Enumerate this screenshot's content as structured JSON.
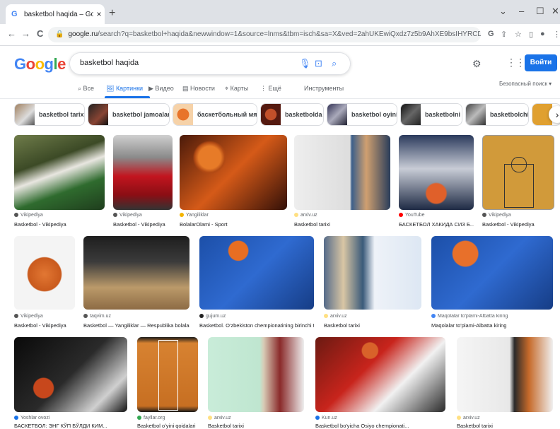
{
  "browser": {
    "tab_title": "basketbol haqida – Google Пои",
    "tab_close": "×",
    "new_tab": "+",
    "url_host": "google.ru",
    "url_rest": "/search?q=basketbol+haqida&newwindow=1&source=lnms&tbm=isch&sa=X&ved=2ahUKEwiQxdz7z5b9AhXE9bsIHYRCD6QQ_AUoAXoECAEQAw",
    "back": "←",
    "forward": "→",
    "reload": "C"
  },
  "google": {
    "logo_letters": [
      {
        "ch": "G",
        "color": "#4285f4"
      },
      {
        "ch": "o",
        "color": "#ea4335"
      },
      {
        "ch": "o",
        "color": "#fbbc05"
      },
      {
        "ch": "g",
        "color": "#4285f4"
      },
      {
        "ch": "l",
        "color": "#34a853"
      },
      {
        "ch": "e",
        "color": "#ea4335"
      }
    ],
    "query": "basketbol haqida",
    "login": "Войти"
  },
  "nav": {
    "tabs": [
      "Все",
      "Картинки",
      "Видео",
      "Новости",
      "Карты",
      "Ещё"
    ],
    "tools": "Инструменты",
    "safesearch": "Безопасный поиск ▾"
  },
  "chips": [
    "basketbol tarixi",
    "basketbol jamoalari",
    "баскетбольный мяч",
    "basketbolda",
    "basketbol oyini",
    "basketbolni",
    "basketbolchi"
  ],
  "results": [
    {
      "source": "Vikipediya",
      "title": "Basketbol - Vikipediya"
    },
    {
      "source": "Vikipediya",
      "title": "Basketbol - Vikipediya"
    },
    {
      "source": "Yangiliklar",
      "title": "BolalarOlami - Sport"
    },
    {
      "source": "arxiv.uz",
      "title": "Basketbol tarixi"
    },
    {
      "source": "YouTube",
      "title": "БАСКЕТБОЛ ХАКИДА СИЗ Б..."
    },
    {
      "source": "Vikipediya",
      "title": "Basketbol - Vikipediya"
    },
    {
      "source": "Vikipediya",
      "title": "Basketbol - Vikipediya"
    },
    {
      "source": "taqvim.uz",
      "title": "Basketbol — Yangiliklar — Respublika bolalar ..."
    },
    {
      "source": "gujum.uz",
      "title": "Basketbol. O'zbekiston chempionatining birinchi t..."
    },
    {
      "source": "arxiv.uz",
      "title": "Basketbol tarixi"
    },
    {
      "source": "Maqolalar to'plami-Albatta kiring",
      "title": "Maqolalar to'plami-Albatta kiring"
    },
    {
      "source": "Yoshlar ovozi",
      "title": "БАСКЕТБОЛ: ЭНГ КЎП БЎЛДИ КИМ..."
    },
    {
      "source": "fayllar.org",
      "title": "Basketbol oʻyini qoidalari"
    },
    {
      "source": "arxiv.uz",
      "title": "Basketbol tarixi"
    },
    {
      "source": "Kun.uz",
      "title": "Basketbol bo'yicha Osiyo chempionati..."
    },
    {
      "source": "arxiv.uz",
      "title": "Basketbol tarixi"
    }
  ]
}
